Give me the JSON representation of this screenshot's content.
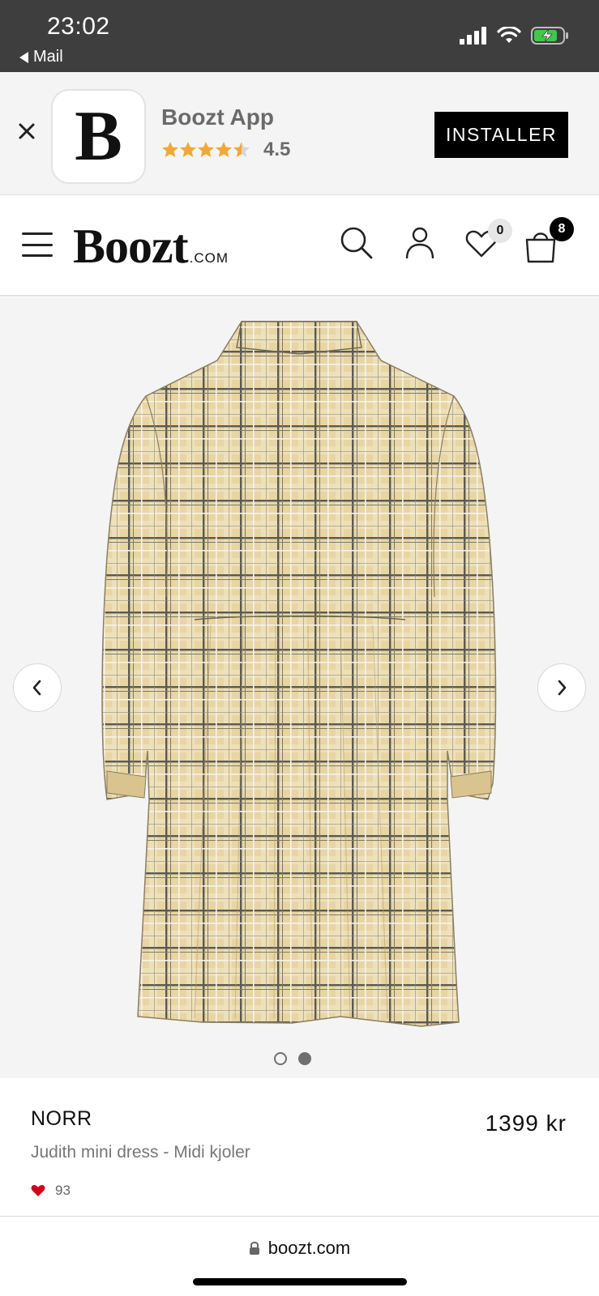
{
  "status_bar": {
    "time": "23:02",
    "back_app": "Mail",
    "icons": [
      "cellular-signal-icon",
      "wifi-icon",
      "battery-charging-icon"
    ]
  },
  "app_banner": {
    "logo_letter": "B",
    "app_name": "Boozt App",
    "rating": "4.5",
    "stars": 4.5,
    "install_label": "INSTALLER",
    "star_color": "#f0a83a"
  },
  "header": {
    "logo_main": "Boozt",
    "logo_suffix": ".COM",
    "wishlist_count": "0",
    "cart_count": "8",
    "icons": [
      "menu-icon",
      "search-icon",
      "account-icon",
      "heart-icon",
      "bag-icon"
    ]
  },
  "gallery": {
    "image_alt": "plaid shirt dress back view",
    "slide_count": 2,
    "active_slide": 2,
    "fabric_colors": [
      "#e8d5a4",
      "#5a5a52",
      "#f4f0e6"
    ]
  },
  "product": {
    "brand": "NORR",
    "name": "Judith mini dress - Midi kjoler",
    "price": "1399 kr",
    "likes": "93",
    "heart_color": "#d0021b"
  },
  "browser": {
    "url": "boozt.com",
    "icons": [
      "lock-icon"
    ]
  }
}
